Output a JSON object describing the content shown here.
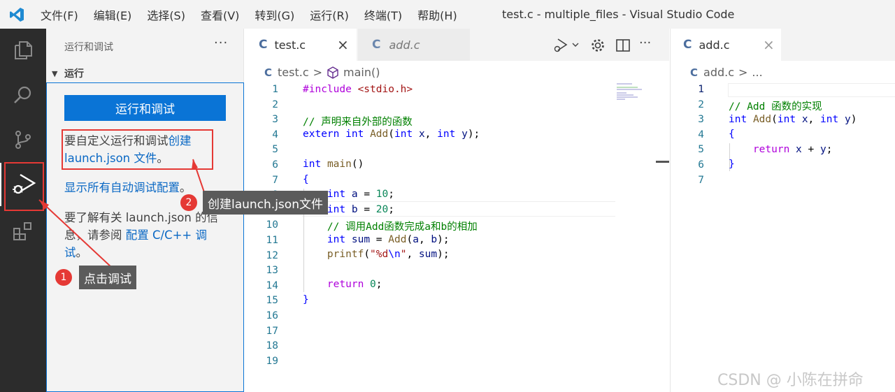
{
  "titlebar": {
    "menu": [
      "文件(F)",
      "编辑(E)",
      "选择(S)",
      "查看(V)",
      "转到(G)",
      "运行(R)",
      "终端(T)",
      "帮助(H)"
    ],
    "window_title": "test.c - multiple_files - Visual Studio Code"
  },
  "activity_bar": {
    "items": [
      {
        "icon": "explorer-icon"
      },
      {
        "icon": "search-icon"
      },
      {
        "icon": "source-control-icon"
      },
      {
        "icon": "run-debug-icon",
        "active": true
      },
      {
        "icon": "extensions-icon"
      }
    ]
  },
  "sidebar": {
    "title": "运行和调试",
    "more": "···",
    "section": "运行",
    "run_button": "运行和调试",
    "custom_text": "要自定义运行和调试",
    "custom_link_1": "创建",
    "custom_link_2": "launch.json 文件",
    "custom_end": "。",
    "show_all_link": "显示所有自动调试配置",
    "show_all_end": "。",
    "learn_text_1": "要了解有关 launch.json 的信",
    "learn_text_2": "息，请参阅 ",
    "learn_link_1": "配置 C/C++ 调",
    "learn_link_2": "试",
    "learn_end": "。"
  },
  "editor1": {
    "tabs": [
      {
        "icon": "C",
        "label": "test.c",
        "active": true,
        "close": "×"
      },
      {
        "icon": "C",
        "label": "add.c",
        "active": false
      }
    ],
    "breadcrumb": {
      "file": "test.c",
      "sep": ">",
      "symbol": "main()"
    },
    "line_numbers": [
      "1",
      "2",
      "3",
      "4",
      "5",
      "6",
      "7",
      "8",
      "9",
      "10",
      "11",
      "12",
      "13",
      "14",
      "15",
      "16",
      "17",
      "18",
      "19"
    ]
  },
  "editor2": {
    "tab": {
      "icon": "C",
      "label": "add.c",
      "close": "×"
    },
    "breadcrumb": {
      "file": "add.c",
      "sep": ">",
      "more": "..."
    },
    "line_numbers": [
      "1",
      "2",
      "3",
      "4",
      "5",
      "6",
      "7"
    ]
  },
  "annotations": {
    "step1_number": "1",
    "step1_text": "点击调试",
    "step2_number": "2",
    "step2_text": "创建launch.json文件",
    "accent_color": "#e53935"
  },
  "watermark": "CSDN @   小陈在拼命"
}
